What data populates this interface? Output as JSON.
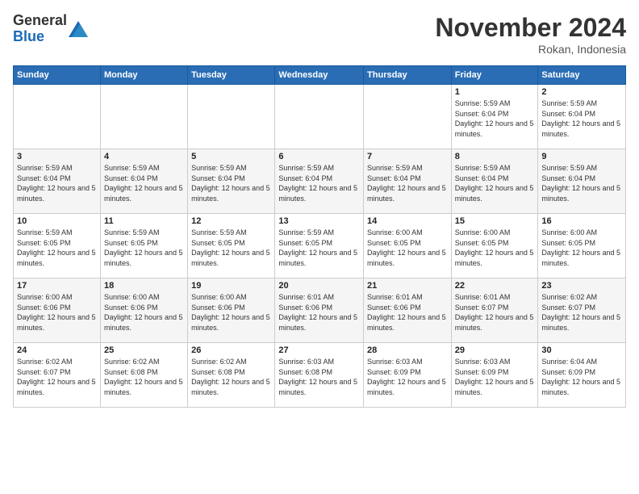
{
  "logo": {
    "line1": "General",
    "line2": "Blue"
  },
  "header": {
    "month_year": "November 2024",
    "location": "Rokan, Indonesia"
  },
  "weekdays": [
    "Sunday",
    "Monday",
    "Tuesday",
    "Wednesday",
    "Thursday",
    "Friday",
    "Saturday"
  ],
  "weeks": [
    [
      {
        "day": "",
        "info": ""
      },
      {
        "day": "",
        "info": ""
      },
      {
        "day": "",
        "info": ""
      },
      {
        "day": "",
        "info": ""
      },
      {
        "day": "",
        "info": ""
      },
      {
        "day": "1",
        "info": "Sunrise: 5:59 AM\nSunset: 6:04 PM\nDaylight: 12 hours and 5 minutes."
      },
      {
        "day": "2",
        "info": "Sunrise: 5:59 AM\nSunset: 6:04 PM\nDaylight: 12 hours and 5 minutes."
      }
    ],
    [
      {
        "day": "3",
        "info": "Sunrise: 5:59 AM\nSunset: 6:04 PM\nDaylight: 12 hours and 5 minutes."
      },
      {
        "day": "4",
        "info": "Sunrise: 5:59 AM\nSunset: 6:04 PM\nDaylight: 12 hours and 5 minutes."
      },
      {
        "day": "5",
        "info": "Sunrise: 5:59 AM\nSunset: 6:04 PM\nDaylight: 12 hours and 5 minutes."
      },
      {
        "day": "6",
        "info": "Sunrise: 5:59 AM\nSunset: 6:04 PM\nDaylight: 12 hours and 5 minutes."
      },
      {
        "day": "7",
        "info": "Sunrise: 5:59 AM\nSunset: 6:04 PM\nDaylight: 12 hours and 5 minutes."
      },
      {
        "day": "8",
        "info": "Sunrise: 5:59 AM\nSunset: 6:04 PM\nDaylight: 12 hours and 5 minutes."
      },
      {
        "day": "9",
        "info": "Sunrise: 5:59 AM\nSunset: 6:04 PM\nDaylight: 12 hours and 5 minutes."
      }
    ],
    [
      {
        "day": "10",
        "info": "Sunrise: 5:59 AM\nSunset: 6:05 PM\nDaylight: 12 hours and 5 minutes."
      },
      {
        "day": "11",
        "info": "Sunrise: 5:59 AM\nSunset: 6:05 PM\nDaylight: 12 hours and 5 minutes."
      },
      {
        "day": "12",
        "info": "Sunrise: 5:59 AM\nSunset: 6:05 PM\nDaylight: 12 hours and 5 minutes."
      },
      {
        "day": "13",
        "info": "Sunrise: 5:59 AM\nSunset: 6:05 PM\nDaylight: 12 hours and 5 minutes."
      },
      {
        "day": "14",
        "info": "Sunrise: 6:00 AM\nSunset: 6:05 PM\nDaylight: 12 hours and 5 minutes."
      },
      {
        "day": "15",
        "info": "Sunrise: 6:00 AM\nSunset: 6:05 PM\nDaylight: 12 hours and 5 minutes."
      },
      {
        "day": "16",
        "info": "Sunrise: 6:00 AM\nSunset: 6:05 PM\nDaylight: 12 hours and 5 minutes."
      }
    ],
    [
      {
        "day": "17",
        "info": "Sunrise: 6:00 AM\nSunset: 6:06 PM\nDaylight: 12 hours and 5 minutes."
      },
      {
        "day": "18",
        "info": "Sunrise: 6:00 AM\nSunset: 6:06 PM\nDaylight: 12 hours and 5 minutes."
      },
      {
        "day": "19",
        "info": "Sunrise: 6:00 AM\nSunset: 6:06 PM\nDaylight: 12 hours and 5 minutes."
      },
      {
        "day": "20",
        "info": "Sunrise: 6:01 AM\nSunset: 6:06 PM\nDaylight: 12 hours and 5 minutes."
      },
      {
        "day": "21",
        "info": "Sunrise: 6:01 AM\nSunset: 6:06 PM\nDaylight: 12 hours and 5 minutes."
      },
      {
        "day": "22",
        "info": "Sunrise: 6:01 AM\nSunset: 6:07 PM\nDaylight: 12 hours and 5 minutes."
      },
      {
        "day": "23",
        "info": "Sunrise: 6:02 AM\nSunset: 6:07 PM\nDaylight: 12 hours and 5 minutes."
      }
    ],
    [
      {
        "day": "24",
        "info": "Sunrise: 6:02 AM\nSunset: 6:07 PM\nDaylight: 12 hours and 5 minutes."
      },
      {
        "day": "25",
        "info": "Sunrise: 6:02 AM\nSunset: 6:08 PM\nDaylight: 12 hours and 5 minutes."
      },
      {
        "day": "26",
        "info": "Sunrise: 6:02 AM\nSunset: 6:08 PM\nDaylight: 12 hours and 5 minutes."
      },
      {
        "day": "27",
        "info": "Sunrise: 6:03 AM\nSunset: 6:08 PM\nDaylight: 12 hours and 5 minutes."
      },
      {
        "day": "28",
        "info": "Sunrise: 6:03 AM\nSunset: 6:09 PM\nDaylight: 12 hours and 5 minutes."
      },
      {
        "day": "29",
        "info": "Sunrise: 6:03 AM\nSunset: 6:09 PM\nDaylight: 12 hours and 5 minutes."
      },
      {
        "day": "30",
        "info": "Sunrise: 6:04 AM\nSunset: 6:09 PM\nDaylight: 12 hours and 5 minutes."
      }
    ]
  ]
}
